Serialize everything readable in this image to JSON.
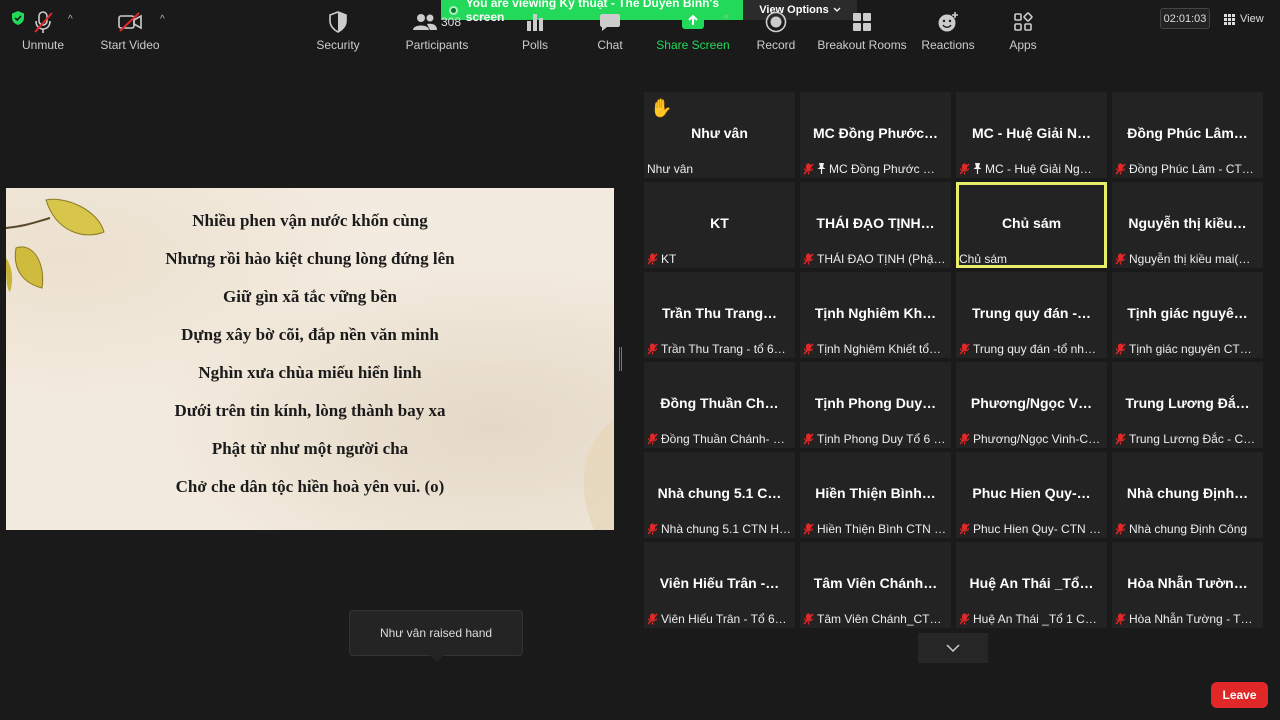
{
  "top_bar": {
    "viewing_banner": "You are viewing Kỹ thuật - Thể Duyên Bình's screen",
    "view_options": "View Options",
    "timer": "02:01:03",
    "view_label": "View"
  },
  "shared_screen": {
    "poem_lines": [
      "Nhiều phen vận nước khốn cùng",
      "Nhưng rồi hào kiệt chung lòng đứng lên",
      "Giữ gìn xã tắc vững bền",
      "Dựng xây bờ cõi, đắp nền văn minh",
      "Nghìn xưa chùa miếu hiển linh",
      "Dưới trên tin kính, lòng thành bay xa",
      "Phật từ như một người cha",
      "Chở che dân tộc hiền hoà yên vui. (o)"
    ]
  },
  "gallery": {
    "tiles": [
      {
        "title": "Như vân",
        "name": "Như vân",
        "muted": false,
        "pinned": false,
        "hand": true,
        "active": false
      },
      {
        "title": "MC Đồng Phước…",
        "name": "MC Đồng Phước …",
        "muted": true,
        "pinned": true,
        "hand": false,
        "active": false
      },
      {
        "title": "MC - Huệ Giải N…",
        "name": "MC - Huệ Giải Ng…",
        "muted": true,
        "pinned": true,
        "hand": false,
        "active": false
      },
      {
        "title": "Đồng Phúc Lâm…",
        "name": "Đồng Phúc Lâm - CT…",
        "muted": true,
        "pinned": false,
        "hand": false,
        "active": false
      },
      {
        "title": "KT",
        "name": "KT",
        "muted": true,
        "pinned": false,
        "hand": false,
        "active": false
      },
      {
        "title": "THÁI ĐẠO TỊNH…",
        "name": "THÁI ĐẠO TỊNH (Phật…",
        "muted": true,
        "pinned": false,
        "hand": false,
        "active": false
      },
      {
        "title": "Chủ sám",
        "name": "Chủ sám",
        "muted": false,
        "pinned": false,
        "hand": false,
        "active": true
      },
      {
        "title": "Nguyễn thị kiều…",
        "name": "Nguyễn thị kiều mai(…",
        "muted": true,
        "pinned": false,
        "hand": false,
        "active": false
      },
      {
        "title": "Trần Thu Trang…",
        "name": "Trần Thu Trang - tổ 6…",
        "muted": true,
        "pinned": false,
        "hand": false,
        "active": false
      },
      {
        "title": "Tịnh Nghiêm Kh…",
        "name": "Tịnh Nghiêm Khiết tổ…",
        "muted": true,
        "pinned": false,
        "hand": false,
        "active": false
      },
      {
        "title": "Trung quy đán -…",
        "name": "Trung quy đán -tổ nh…",
        "muted": true,
        "pinned": false,
        "hand": false,
        "active": false
      },
      {
        "title": "Tịnh giác nguyê…",
        "name": "Tịnh giác nguyên CT…",
        "muted": true,
        "pinned": false,
        "hand": false,
        "active": false
      },
      {
        "title": "Đồng Thuần Ch…",
        "name": "Đồng Thuần Chánh- …",
        "muted": true,
        "pinned": false,
        "hand": false,
        "active": false
      },
      {
        "title": "Tịnh Phong Duy…",
        "name": "Tịnh Phong Duy Tổ 6 …",
        "muted": true,
        "pinned": false,
        "hand": false,
        "active": false
      },
      {
        "title": "Phương/Ngọc V…",
        "name": "Phương/Ngọc Vinh-C…",
        "muted": true,
        "pinned": false,
        "hand": false,
        "active": false
      },
      {
        "title": "Trung Lương Đắ…",
        "name": "Trung Lương Đắc - C…",
        "muted": true,
        "pinned": false,
        "hand": false,
        "active": false
      },
      {
        "title": "Nhà chung 5.1 C…",
        "name": "Nhà chung 5.1 CTN H…",
        "muted": true,
        "pinned": false,
        "hand": false,
        "active": false
      },
      {
        "title": "Hiền Thiện Bình…",
        "name": "Hiền Thiện Bình  CTN …",
        "muted": true,
        "pinned": false,
        "hand": false,
        "active": false
      },
      {
        "title": "Phuc Hien Quy-…",
        "name": "Phuc Hien Quy- CTN …",
        "muted": true,
        "pinned": false,
        "hand": false,
        "active": false
      },
      {
        "title": "Nhà chung Định…",
        "name": "Nhà chung Định Công",
        "muted": true,
        "pinned": false,
        "hand": false,
        "active": false
      },
      {
        "title": "Viên Hiếu Trân -…",
        "name": "Viên Hiếu Trân - Tổ 6…",
        "muted": true,
        "pinned": false,
        "hand": false,
        "active": false
      },
      {
        "title": "Tâm Viên Chánh…",
        "name": "Tâm Viên Chánh_CTN…",
        "muted": true,
        "pinned": false,
        "hand": false,
        "active": false
      },
      {
        "title": "Huệ An Thái _Tổ…",
        "name": "Huệ An Thái _Tổ 1 CT…",
        "muted": true,
        "pinned": false,
        "hand": false,
        "active": false
      },
      {
        "title": "Hòa Nhẫn Tườn…",
        "name": "Hòa Nhẫn Tường - T…",
        "muted": true,
        "pinned": false,
        "hand": false,
        "active": false
      }
    ]
  },
  "tooltip": {
    "text": "Như vân raised hand"
  },
  "toolbar": {
    "unmute": "Unmute",
    "start_video": "Start Video",
    "security": "Security",
    "participants": "Participants",
    "participants_count": "308",
    "polls": "Polls",
    "chat": "Chat",
    "share_screen": "Share Screen",
    "record": "Record",
    "breakout_rooms": "Breakout Rooms",
    "reactions": "Reactions",
    "apps": "Apps",
    "leave": "Leave"
  },
  "colors": {
    "accent_green": "#23d959",
    "leave_red": "#e02828",
    "active_speaker": "#e7ef6a",
    "muted_red": "#e02828"
  }
}
